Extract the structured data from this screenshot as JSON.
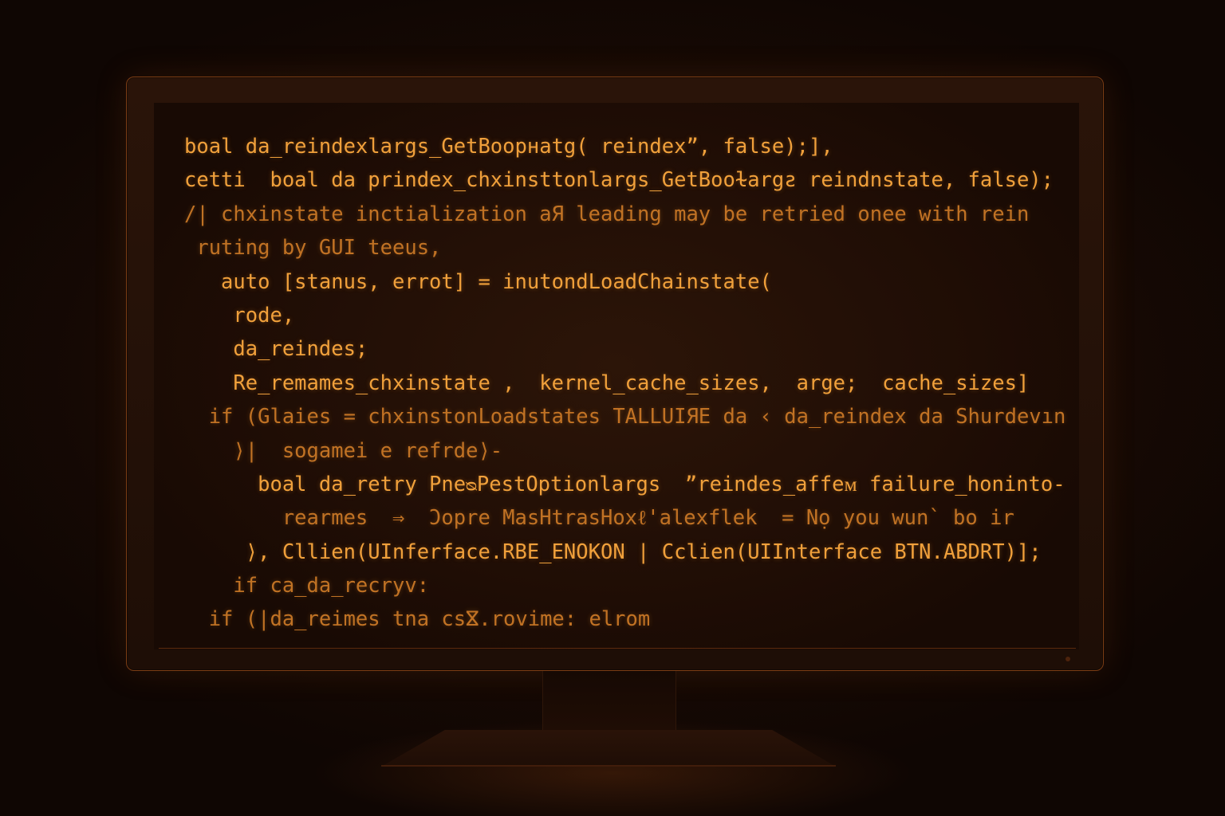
{
  "code_lines": [
    "boal da_reindexlargs_GetBoopнatg( reindex”, false);],",
    "cetti  boal da рrindex_chxinsttonlargs_GetBooɫargƨ reindnstate, false);",
    "/| chxinstate inctialization aЯ leading may be retried onee with rein",
    " ruting by GUI teeus,",
    "   auto [stanus, errot] = inutondLoadChainstate(",
    "    rode,",
    "    da_reindes;",
    "    Re_remames_chxinstate ,  kernel_cache_sizes,  arge;  cache_sizes]",
    "  if (Glaies = chxinstonLoadstates TALLUIЯE da ‹ da_reindex da Shurdevın",
    "    ⟩|  sogamei e refrde⟩-",
    "      boal da_retry PneᴓPestOptionlargs  ”reindes_affeᴍ failure_honinto-",
    "        rearmes  ⇒  Ɔopre MasНtrasHoxℓ'alexflek  = Nọ you wun` bo ir",
    "     ⟩, Cllien(UInferface.RBE_ENOKON | Cclien(UIInterface BTN.ABDRT)];",
    "    if ca_da_recryv:",
    "  if (|da_reimes tna csⴵ.rovime: elrom"
  ],
  "colors": {
    "code_text": "#e9922f",
    "background": "#140904",
    "bezel_border": "#7a3c14"
  }
}
